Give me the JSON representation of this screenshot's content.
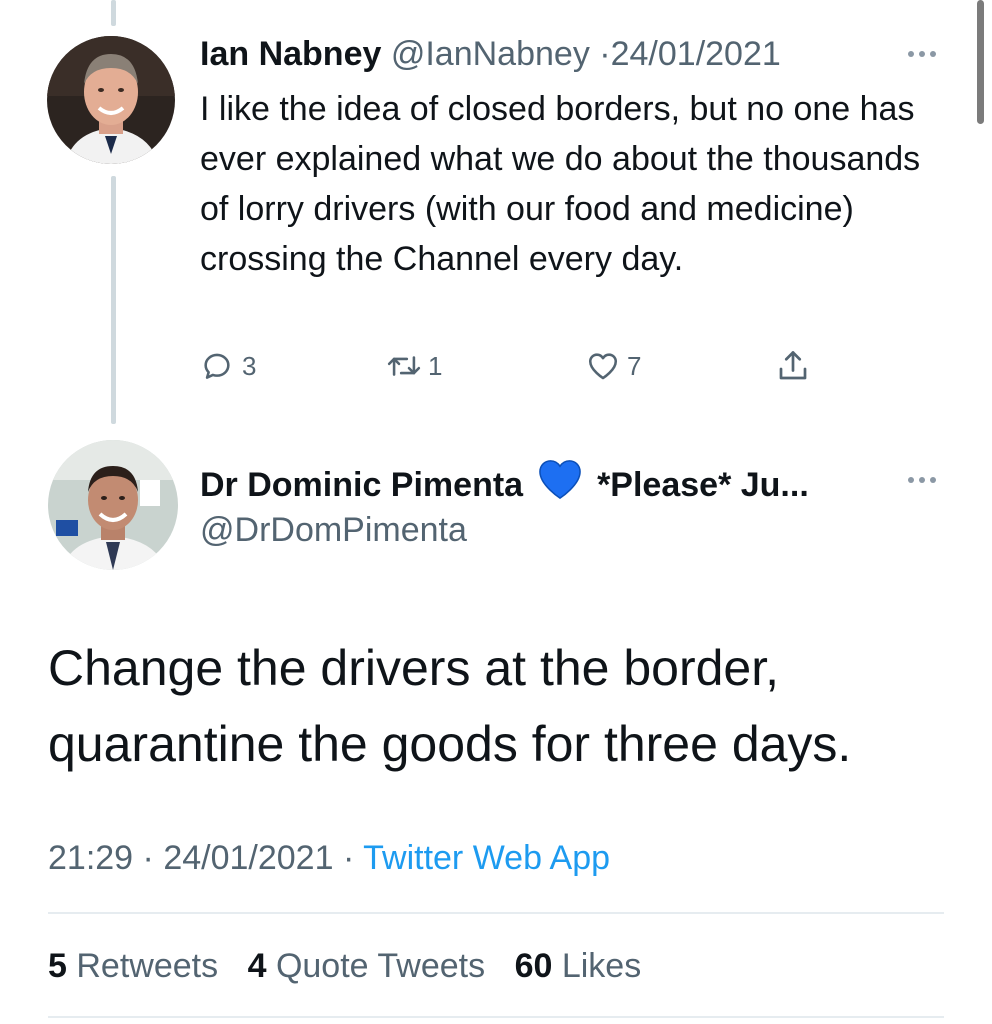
{
  "reply_tweet": {
    "author_name": "Ian Nabney",
    "handle": "@IanNabney",
    "separator": "·",
    "date": "24/01/2021",
    "text": "I like the idea of closed borders, but no one has ever explained what we do about the thousands of lorry drivers (with our food and medicine) crossing the Channel every day.",
    "actions": {
      "reply_count": "3",
      "retweet_count": "1",
      "like_count": "7"
    },
    "icons": [
      "reply-icon",
      "retweet-icon",
      "like-icon",
      "share-icon",
      "more-icon"
    ]
  },
  "main_tweet": {
    "author_name": "Dr Dominic Pimenta",
    "name_suffix": "*Please* Ju...",
    "heart_emoji_color": "#1d6ff2",
    "handle": "@DrDomPimenta",
    "text": "Change the drivers at the border, quarantine the goods for three days.",
    "time": "21:29",
    "dot": "·",
    "date": "24/01/2021",
    "source": "Twitter Web App",
    "stats": {
      "retweets_count": "5",
      "retweets_label": "Retweets",
      "quote_count": "4",
      "quote_label": "Quote Tweets",
      "likes_count": "60",
      "likes_label": "Likes"
    }
  },
  "colors": {
    "text_primary": "#0f1419",
    "text_secondary": "#536471",
    "link": "#1d9bf0",
    "divider": "#e6ecf0",
    "thread_line": "#cfd9de"
  }
}
